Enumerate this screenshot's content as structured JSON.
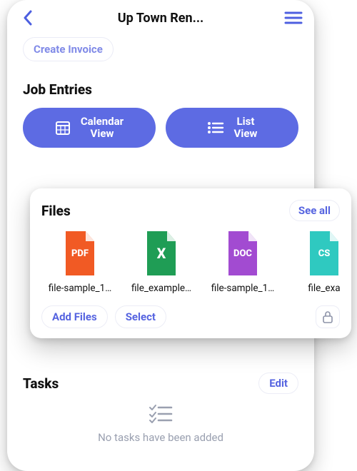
{
  "nav": {
    "title": "Up Town Ren..."
  },
  "create_invoice_label": "Create Invoice",
  "job_entries": {
    "title": "Job Entries",
    "calendar_label": "Calendar\nView",
    "list_label": "List\nView"
  },
  "files": {
    "title": "Files",
    "see_all": "See all",
    "add_files": "Add Files",
    "select": "Select",
    "items": [
      {
        "label": "file-sample_1…",
        "badge": "PDF",
        "color": "#f15a24"
      },
      {
        "label": "file_example…",
        "badge": "X",
        "color": "#1f9d55"
      },
      {
        "label": "file-sample_1…",
        "badge": "DOC",
        "color": "#a24bd1"
      },
      {
        "label": "file_exa",
        "badge": "CS",
        "color": "#2fc9c0"
      }
    ]
  },
  "tasks": {
    "title": "Tasks",
    "edit": "Edit",
    "empty_text": "No tasks have been added"
  }
}
